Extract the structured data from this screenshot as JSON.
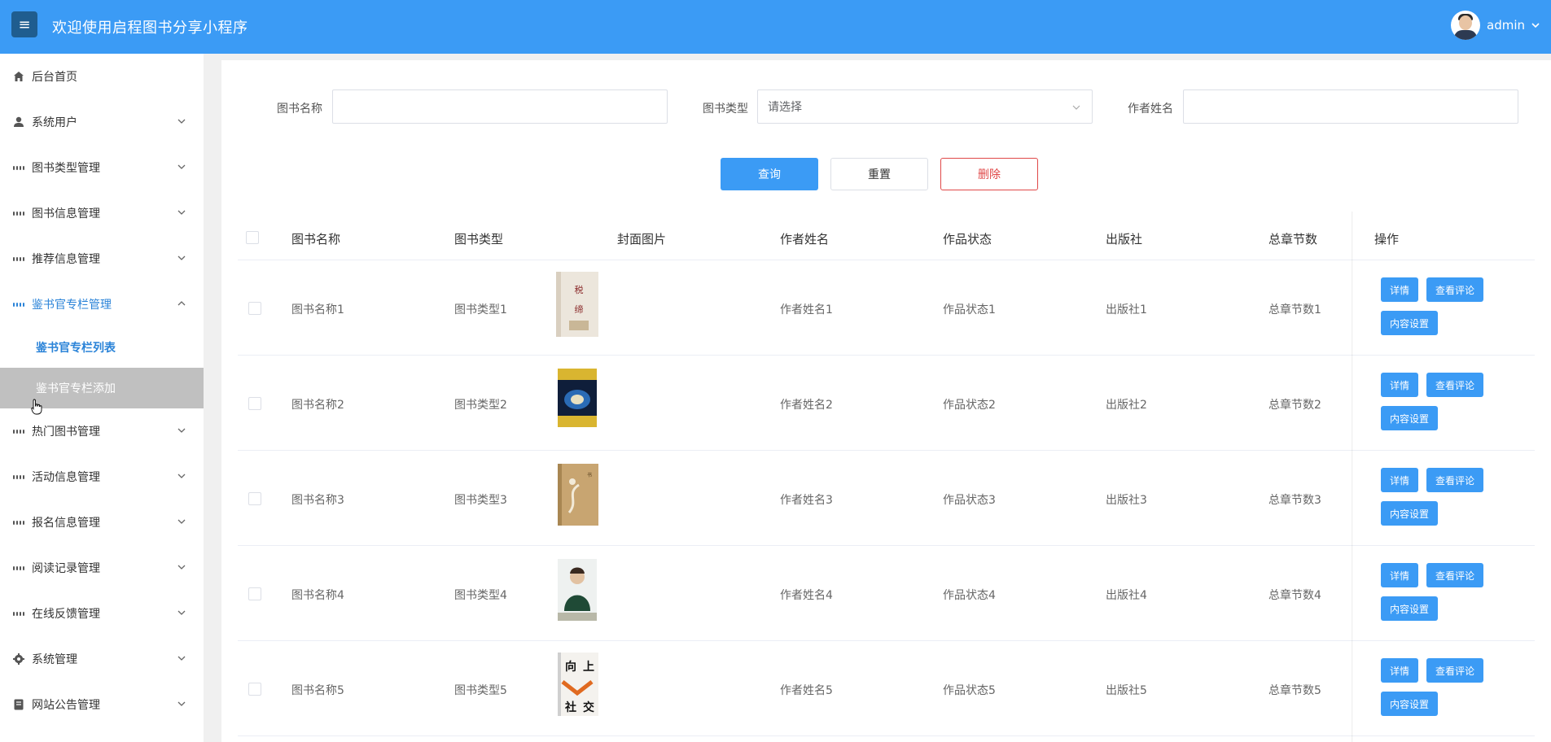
{
  "header": {
    "menu_icon": "hamburger-icon",
    "title": "欢迎使用启程图书分享小程序",
    "username": "admin",
    "accent": "#3b9bf5"
  },
  "sidebar": {
    "items": [
      {
        "label": "后台首页",
        "icon": "home-icon"
      },
      {
        "label": "系统用户",
        "icon": "user-icon"
      },
      {
        "label": "图书类型管理",
        "icon": "grid-icon"
      },
      {
        "label": "图书信息管理",
        "icon": "grid-icon"
      },
      {
        "label": "推荐信息管理",
        "icon": "grid-icon"
      },
      {
        "label": "鉴书官专栏管理",
        "icon": "grid-icon"
      },
      {
        "label": "热门图书管理",
        "icon": "grid-icon"
      },
      {
        "label": "活动信息管理",
        "icon": "grid-icon"
      },
      {
        "label": "报名信息管理",
        "icon": "grid-icon"
      },
      {
        "label": "阅读记录管理",
        "icon": "grid-icon"
      },
      {
        "label": "在线反馈管理",
        "icon": "grid-icon"
      },
      {
        "label": "系统管理",
        "icon": "gear-icon"
      },
      {
        "label": "网站公告管理",
        "icon": "document-icon"
      }
    ],
    "subitems": [
      {
        "label": "鉴书官专栏列表"
      },
      {
        "label": "鉴书官专栏添加"
      }
    ]
  },
  "search": {
    "book_name_label": "图书名称",
    "book_name_value": "",
    "book_type_label": "图书类型",
    "book_type_placeholder": "请选择",
    "author_label": "作者姓名",
    "author_value": ""
  },
  "actions": {
    "query": "查询",
    "reset": "重置",
    "delete": "删除"
  },
  "table": {
    "columns": [
      "图书名称",
      "图书类型",
      "封面图片",
      "作者姓名",
      "作品状态",
      "出版社",
      "总章节数",
      "操作"
    ],
    "row_buttons": {
      "detail": "详情",
      "comments": "查看评论",
      "content": "内容设置"
    },
    "rows": [
      {
        "name": "图书名称1",
        "type": "图书类型1",
        "author": "作者姓名1",
        "status": "作品状态1",
        "publisher": "出版社1",
        "chapters": "总章节数1"
      },
      {
        "name": "图书名称2",
        "type": "图书类型2",
        "author": "作者姓名2",
        "status": "作品状态2",
        "publisher": "出版社2",
        "chapters": "总章节数2"
      },
      {
        "name": "图书名称3",
        "type": "图书类型3",
        "author": "作者姓名3",
        "status": "作品状态3",
        "publisher": "出版社3",
        "chapters": "总章节数3"
      },
      {
        "name": "图书名称4",
        "type": "图书类型4",
        "author": "作者姓名4",
        "status": "作品状态4",
        "publisher": "出版社4",
        "chapters": "总章节数4"
      },
      {
        "name": "图书名称5",
        "type": "图书类型5",
        "author": "作者姓名5",
        "status": "作品状态5",
        "publisher": "出版社5",
        "chapters": "总章节数5"
      }
    ]
  }
}
